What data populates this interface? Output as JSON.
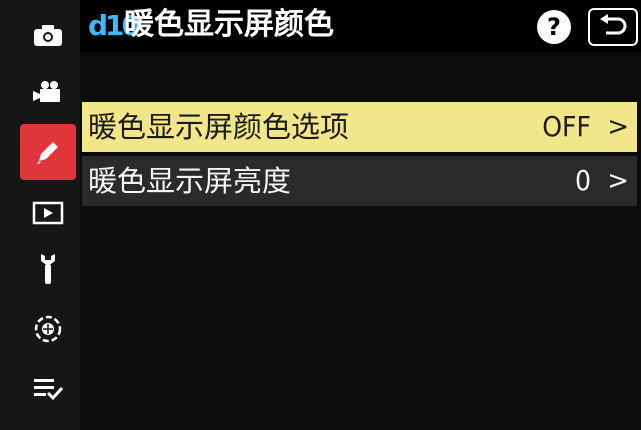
{
  "header": {
    "badge": "d10",
    "title": "暖色显示屏颜色",
    "help_label": "?",
    "back_icon": "back-arrow-icon"
  },
  "sidebar": {
    "items": [
      {
        "icon": "camera-icon",
        "active": false
      },
      {
        "icon": "video-camera-icon",
        "active": false
      },
      {
        "icon": "pencil-icon",
        "active": true
      },
      {
        "icon": "playback-icon",
        "active": false
      },
      {
        "icon": "wrench-icon",
        "active": false
      },
      {
        "icon": "network-icon",
        "active": false
      },
      {
        "icon": "my-menu-icon",
        "active": false
      }
    ]
  },
  "menu": {
    "rows": [
      {
        "label": "暖色显示屏颜色选项",
        "value": "OFF",
        "chevron": ">",
        "selected": true
      },
      {
        "label": "暖色显示屏亮度",
        "value": "0",
        "chevron": ">",
        "selected": false
      }
    ]
  },
  "colors": {
    "active_tab": "#e0353b",
    "selected_row": "#f2e68a",
    "badge": "#3fb8ff"
  }
}
